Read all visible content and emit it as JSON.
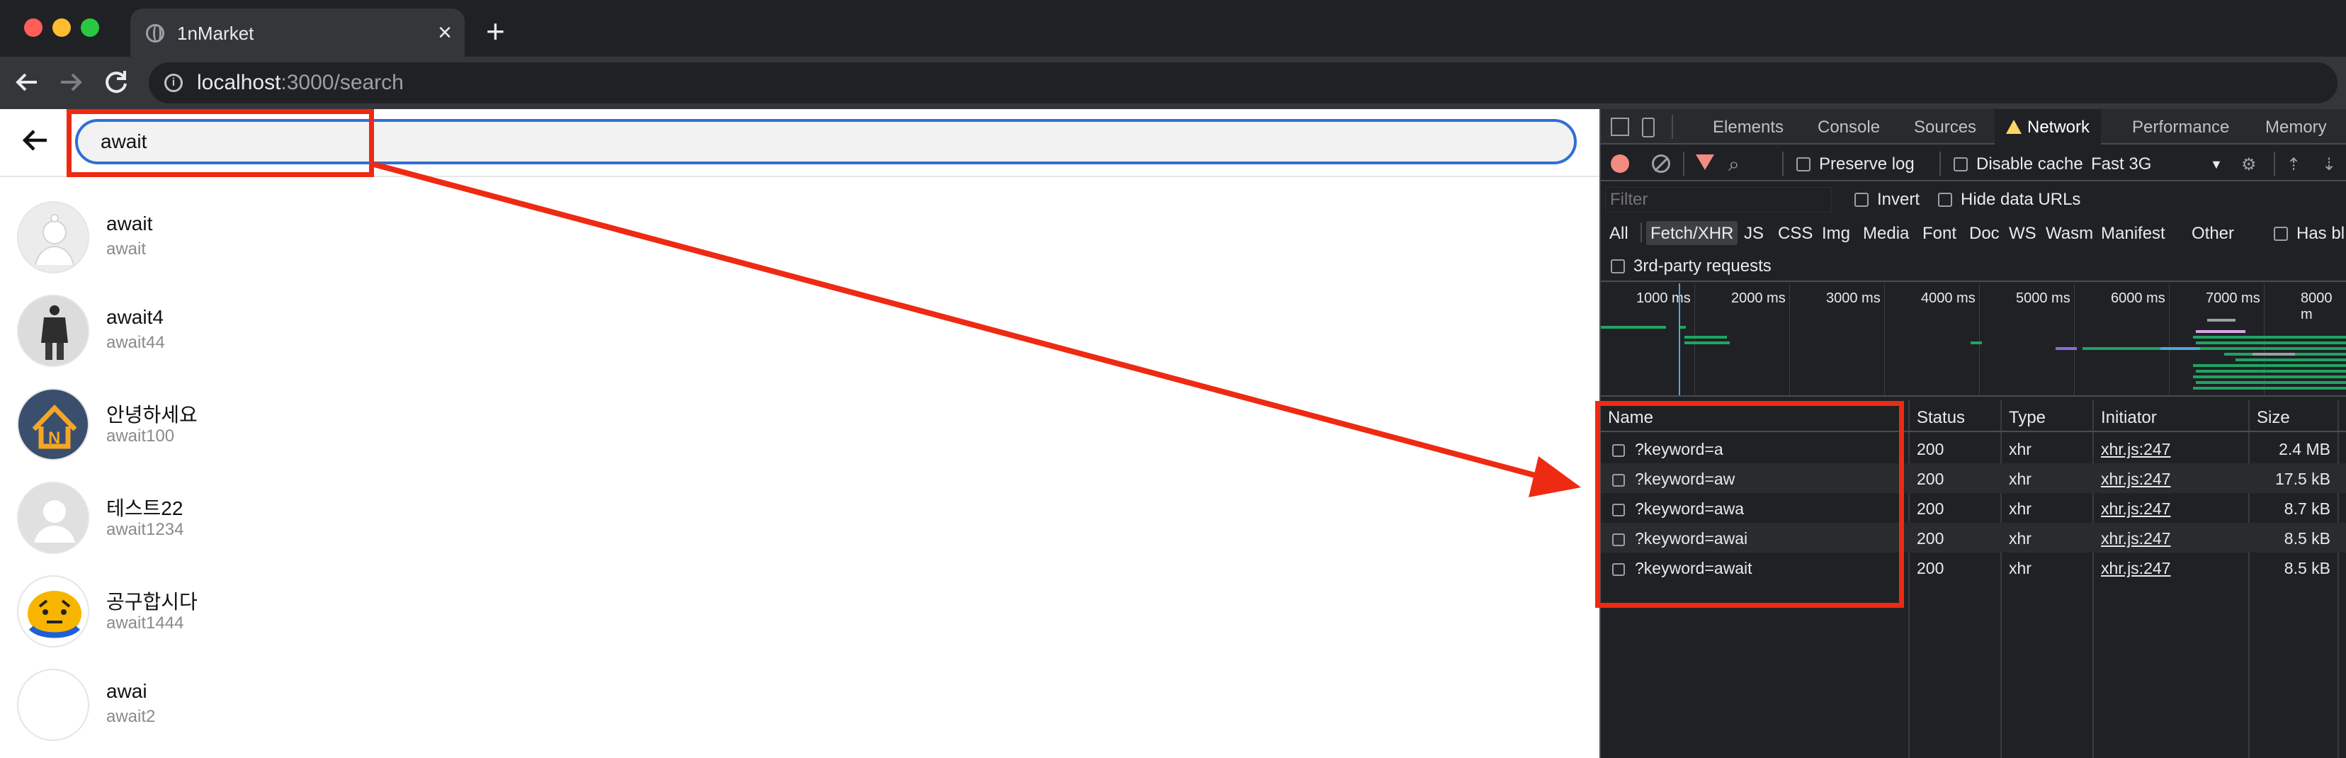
{
  "browser": {
    "tab_title": "1nMarket",
    "url_host": "localhost",
    "url_path": ":3000/search",
    "new_tab": "+",
    "close_tab": "×"
  },
  "search": {
    "value": "await"
  },
  "users": [
    {
      "name": "await",
      "id": "await",
      "avatar": "default-silhouette-icon"
    },
    {
      "name": "await4",
      "id": "await44",
      "avatar": "person-photo"
    },
    {
      "name": "안녕하세요",
      "id": "await100",
      "avatar": "house-n-logo"
    },
    {
      "name": "테스트22",
      "id": "await1234",
      "avatar": "default-person-icon"
    },
    {
      "name": "공구합시다",
      "id": "await1444",
      "avatar": "cartoon-face"
    },
    {
      "name": "awai",
      "id": "await2",
      "avatar": "blank"
    }
  ],
  "devtools": {
    "tabs": [
      "Elements",
      "Console",
      "Sources",
      "Network",
      "Performance",
      "Memory"
    ],
    "active_tab": "Network",
    "toolbar": {
      "preserve_log": "Preserve log",
      "disable_cache": "Disable cache",
      "throttle": "Fast 3G",
      "dropdown": "▼"
    },
    "filter": {
      "placeholder": "Filter",
      "invert": "Invert",
      "hide_data_urls": "Hide data URLs"
    },
    "types": [
      "All",
      "Fetch/XHR",
      "JS",
      "CSS",
      "Img",
      "Media",
      "Font",
      "Doc",
      "WS",
      "Wasm",
      "Manifest",
      "Other",
      "Has bl"
    ],
    "active_type": "Fetch/XHR",
    "third_party": "3rd-party requests",
    "timeline_ticks": [
      "1000 ms",
      "2000 ms",
      "3000 ms",
      "4000 ms",
      "5000 ms",
      "6000 ms",
      "7000 ms",
      "8000 m"
    ],
    "columns": [
      "Name",
      "Status",
      "Type",
      "Initiator",
      "Size"
    ],
    "requests": [
      {
        "name": "?keyword=a",
        "status": "200",
        "type": "xhr",
        "initiator": "xhr.js:247",
        "size": "2.4 MB"
      },
      {
        "name": "?keyword=aw",
        "status": "200",
        "type": "xhr",
        "initiator": "xhr.js:247",
        "size": "17.5 kB"
      },
      {
        "name": "?keyword=awa",
        "status": "200",
        "type": "xhr",
        "initiator": "xhr.js:247",
        "size": "8.7 kB"
      },
      {
        "name": "?keyword=awai",
        "status": "200",
        "type": "xhr",
        "initiator": "xhr.js:247",
        "size": "8.5 kB"
      },
      {
        "name": "?keyword=await",
        "status": "200",
        "type": "xhr",
        "initiator": "xhr.js:247",
        "size": "8.5 kB"
      }
    ]
  },
  "colors": {
    "annotation": "#ee2a12",
    "search_border": "#2f6fd6",
    "devtools_bg": "#202124"
  }
}
